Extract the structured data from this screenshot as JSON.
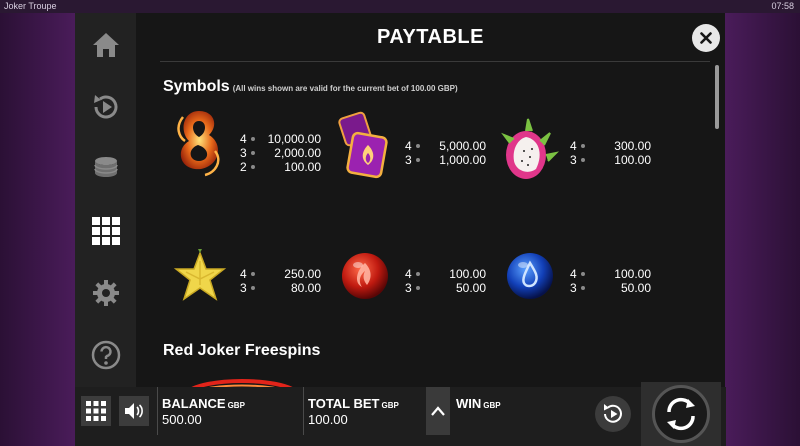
{
  "window": {
    "title": "Joker Troupe",
    "clock": "07:58"
  },
  "sidebar": {
    "items": [
      {
        "icon": "home-icon"
      },
      {
        "icon": "replay-icon"
      },
      {
        "icon": "coins-icon"
      },
      {
        "icon": "paytable-grid-icon"
      },
      {
        "icon": "settings-icon"
      },
      {
        "icon": "help-icon"
      }
    ]
  },
  "paytable": {
    "title": "PAYTABLE",
    "symbols_heading": "Symbols",
    "symbols_note": "(All wins shown are valid for the current bet of 100.00 GBP)",
    "freespins_heading": "Red Joker Freespins",
    "symbols": [
      {
        "icon": "golden-eight-icon",
        "pays": [
          {
            "count": "4",
            "amount": "10,000.00"
          },
          {
            "count": "3",
            "amount": "2,000.00"
          },
          {
            "count": "2",
            "amount": "100.00"
          }
        ]
      },
      {
        "icon": "purple-dice-icon",
        "pays": [
          {
            "count": "4",
            "amount": "5,000.00"
          },
          {
            "count": "3",
            "amount": "1,000.00"
          }
        ]
      },
      {
        "icon": "dragon-fruit-icon",
        "pays": [
          {
            "count": "4",
            "amount": "300.00"
          },
          {
            "count": "3",
            "amount": "100.00"
          }
        ]
      },
      {
        "icon": "star-fruit-icon",
        "pays": [
          {
            "count": "4",
            "amount": "250.00"
          },
          {
            "count": "3",
            "amount": "80.00"
          }
        ]
      },
      {
        "icon": "red-fire-orb-icon",
        "pays": [
          {
            "count": "4",
            "amount": "100.00"
          },
          {
            "count": "3",
            "amount": "50.00"
          }
        ]
      },
      {
        "icon": "blue-water-orb-icon",
        "pays": [
          {
            "count": "4",
            "amount": "100.00"
          },
          {
            "count": "3",
            "amount": "50.00"
          }
        ]
      }
    ]
  },
  "bottombar": {
    "balance_label": "BALANCE",
    "balance_currency": "GBP",
    "balance_value": "500.00",
    "totalbet_label": "TOTAL BET",
    "totalbet_currency": "GBP",
    "totalbet_value": "100.00",
    "win_label": "WIN",
    "win_currency": "GBP"
  },
  "colors": {
    "accent_purple": "#4a1c5a",
    "panel_bg": "#161616",
    "sidebar_bg": "#222222"
  }
}
